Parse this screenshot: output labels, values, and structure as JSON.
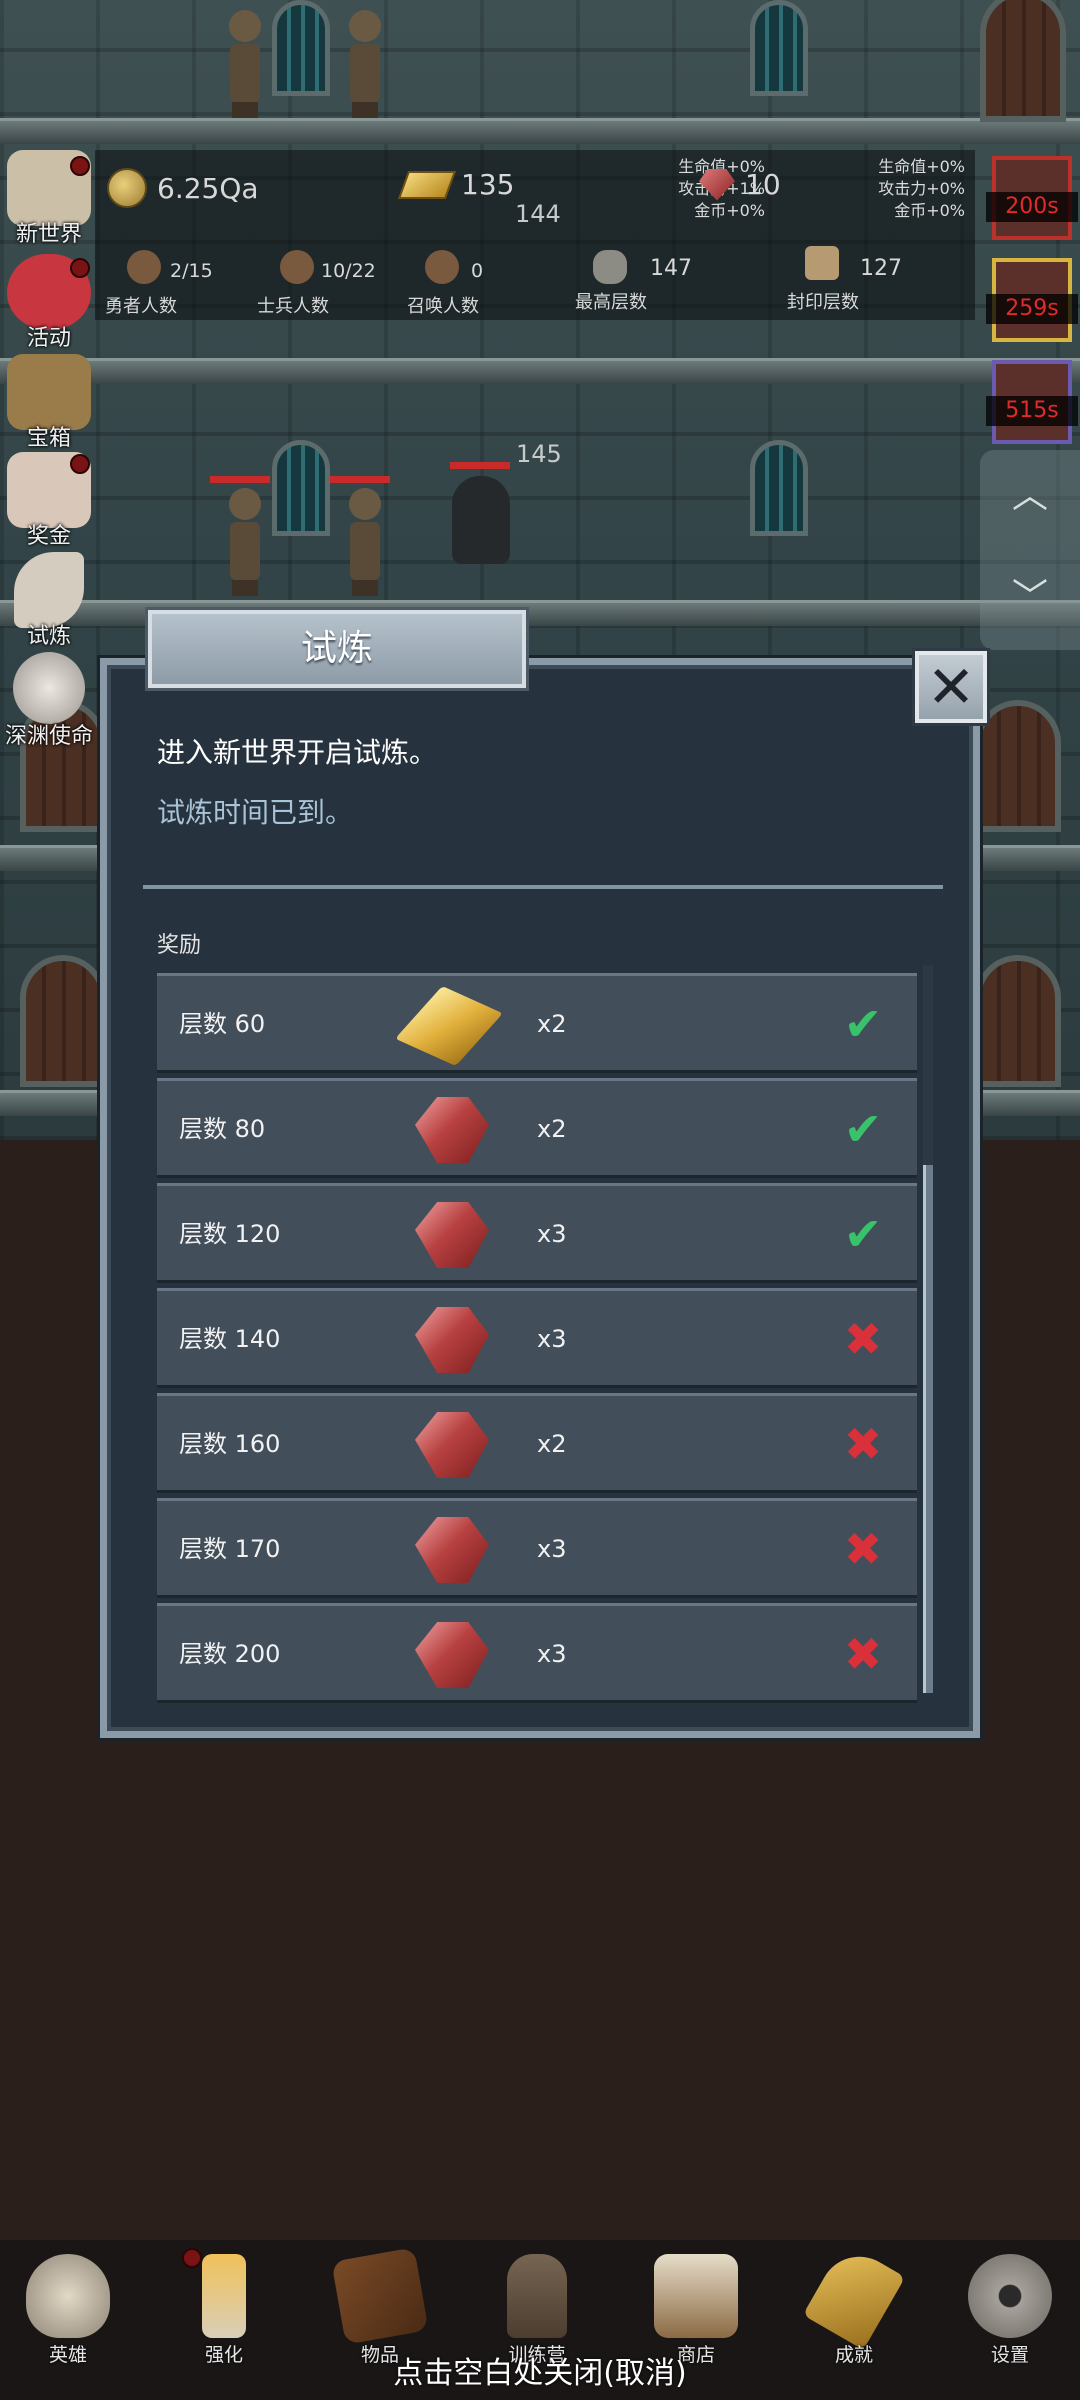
{
  "hud": {
    "coins": "6.25Qa",
    "gold": "135",
    "rubies": "10",
    "floor_above": "144",
    "floor_main": "145",
    "bonus_left": [
      "生命值+0%",
      "攻击力+1%",
      "金币+0%"
    ],
    "bonus_right": [
      "生命值+0%",
      "攻击力+0%",
      "金币+0%"
    ],
    "heroes": {
      "count": "2/15",
      "label": "勇者人数"
    },
    "soldiers": {
      "count": "10/22",
      "label": "士兵人数"
    },
    "summons": {
      "count": "0",
      "label": "召唤人数"
    },
    "highest": {
      "count": "147",
      "label": "最高层数"
    },
    "sealed": {
      "count": "127",
      "label": "封印层数"
    }
  },
  "side_menu": [
    {
      "label": "新世界",
      "icon": "scroll-map-icon",
      "dot": true
    },
    {
      "label": "活动",
      "icon": "heart-icon",
      "dot": true
    },
    {
      "label": "宝箱",
      "icon": "chest-icon",
      "dot": false
    },
    {
      "label": "奖金",
      "icon": "envelope-icon",
      "dot": true
    },
    {
      "label": "试炼",
      "icon": "feather-icon",
      "dot": false
    },
    {
      "label": "深渊使命",
      "icon": "orb-icon",
      "dot": false
    }
  ],
  "timers": [
    "200s",
    "259s",
    "515s"
  ],
  "dialog": {
    "title": "试炼",
    "desc1": "进入新世界开启试炼。",
    "desc2": "试炼时间已到。",
    "reward_label": "奖励",
    "rows": [
      {
        "level": "层数 60",
        "item": "gold",
        "qty": "x2",
        "done": true
      },
      {
        "level": "层数 80",
        "item": "ruby",
        "qty": "x2",
        "done": true
      },
      {
        "level": "层数 120",
        "item": "ruby",
        "qty": "x3",
        "done": true
      },
      {
        "level": "层数 140",
        "item": "ruby",
        "qty": "x3",
        "done": false
      },
      {
        "level": "层数 160",
        "item": "ruby",
        "qty": "x2",
        "done": false
      },
      {
        "level": "层数 170",
        "item": "ruby",
        "qty": "x3",
        "done": false
      },
      {
        "level": "层数 200",
        "item": "ruby",
        "qty": "x3",
        "done": false
      }
    ]
  },
  "bottom_nav": [
    {
      "label": "英雄",
      "icon": "skull-icon"
    },
    {
      "label": "强化",
      "icon": "candle-icon"
    },
    {
      "label": "物品",
      "icon": "book-icon"
    },
    {
      "label": "训练营",
      "icon": "lantern-icon"
    },
    {
      "label": "商店",
      "icon": "mug-icon"
    },
    {
      "label": "成就",
      "icon": "key-icon"
    },
    {
      "label": "设置",
      "icon": "gear-icon"
    }
  ],
  "close_hint": "点击空白处关闭(取消)",
  "colors": {
    "ok": "#38c26a",
    "no": "#d9303a",
    "timer": "#e12a2a"
  }
}
